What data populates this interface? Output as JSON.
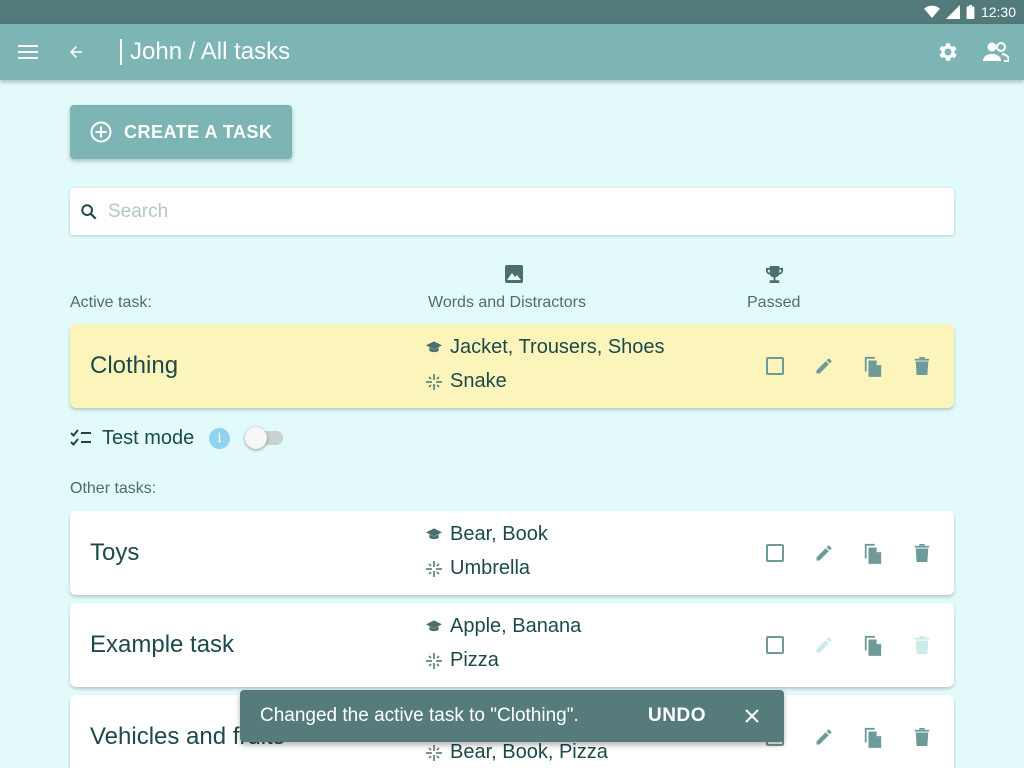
{
  "status_bar": {
    "time": "12:30"
  },
  "app_bar": {
    "title": "John / All tasks"
  },
  "create_button": {
    "label": "CREATE A TASK"
  },
  "search": {
    "placeholder": "Search",
    "value": ""
  },
  "columns": {
    "active_task": "Active task:",
    "words_distractors": "Words and Distractors",
    "passed": "Passed"
  },
  "active_task": {
    "name": "Clothing",
    "words": "Jacket, Trousers, Shoes",
    "distractors": "Snake",
    "passed": false
  },
  "test_mode": {
    "label": "Test mode",
    "info": "i",
    "enabled": false
  },
  "other_tasks_label": "Other tasks:",
  "other_tasks": [
    {
      "name": "Toys",
      "words": "Bear, Book",
      "distractors": "Umbrella",
      "passed": false,
      "edit_enabled": true,
      "delete_enabled": true
    },
    {
      "name": "Example task",
      "words": "Apple, Banana",
      "distractors": "Pizza",
      "passed": false,
      "edit_enabled": false,
      "delete_enabled": false
    },
    {
      "name": "Vehicles and fruits",
      "words": "",
      "distractors": "Bear, Book, Pizza",
      "passed": false,
      "edit_enabled": true,
      "delete_enabled": true
    }
  ],
  "snackbar": {
    "message": "Changed the active task to \"Clothing\".",
    "action": "UNDO"
  },
  "colors": {
    "app_bar": "#7cb5b4",
    "status_bar": "#527a7a",
    "background": "#e2fafa",
    "active_card": "#fbf4bb",
    "icon": "#6f9a9a",
    "snackbar": "#557c7b"
  }
}
